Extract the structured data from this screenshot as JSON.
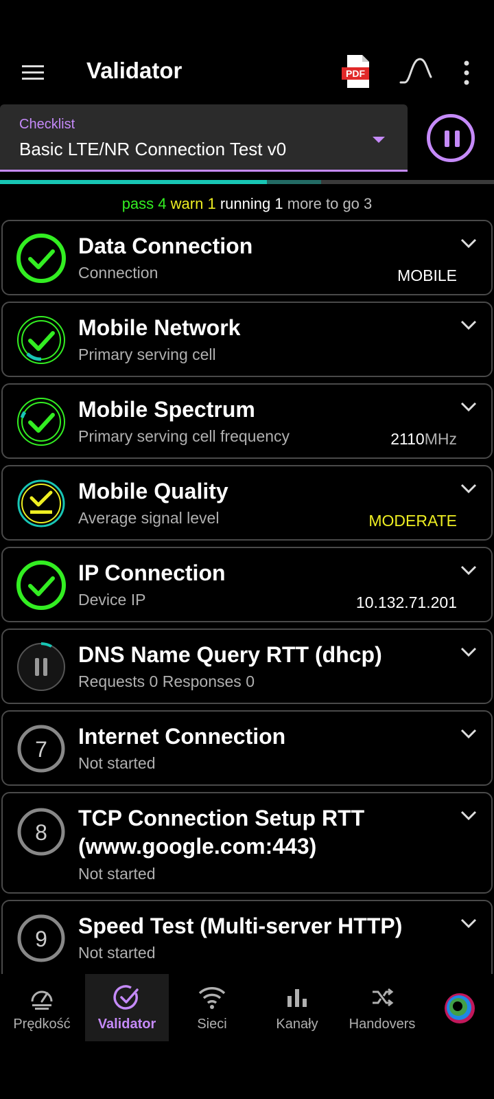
{
  "appbar": {
    "title": "Validator",
    "pdf_label": "PDF"
  },
  "checklist": {
    "label": "Checklist",
    "value": "Basic LTE/NR Connection Test v0"
  },
  "progress": {
    "pass_fraction": 0.54,
    "running_fraction": 0.11
  },
  "summary": {
    "pass_label": "pass",
    "pass_count": "4",
    "warn_label": "warn",
    "warn_count": "1",
    "running_label": "running",
    "running_count": "1",
    "more_label": "more to go",
    "more_count": "3"
  },
  "tests": [
    {
      "title": "Data Connection",
      "subtitle": "Connection",
      "value": "MOBILE",
      "value_unit": "",
      "status": "pass"
    },
    {
      "title": "Mobile Network",
      "subtitle": "Primary serving cell",
      "value": "",
      "value_unit": "",
      "status": "pass"
    },
    {
      "title": "Mobile Spectrum",
      "subtitle": "Primary serving cell frequency",
      "value": "2110",
      "value_unit": "MHz",
      "status": "pass"
    },
    {
      "title": "Mobile Quality",
      "subtitle": "Average signal level",
      "value": "MODERATE",
      "value_unit": "",
      "status": "warn"
    },
    {
      "title": "IP Connection",
      "subtitle": "Device IP",
      "value": "10.132.71.201",
      "value_unit": "",
      "status": "pass"
    },
    {
      "title": "DNS Name Query RTT (dhcp)",
      "subtitle": "Requests 0 Responses 0",
      "value": "",
      "value_unit": "",
      "status": "running"
    },
    {
      "title": "Internet Connection",
      "subtitle": "Not started",
      "value": "",
      "value_unit": "",
      "status": "pending",
      "number": "7"
    },
    {
      "title": "TCP Connection Setup RTT (www.google.com:443)",
      "subtitle": "Not started",
      "value": "",
      "value_unit": "",
      "status": "pending",
      "number": "8"
    },
    {
      "title": "Speed Test (Multi-server HTTP)",
      "subtitle": "Not started",
      "value": "",
      "value_unit": "",
      "status": "pending",
      "number": "9"
    }
  ],
  "nav": [
    {
      "label": "Prędkość",
      "icon": "speedometer-icon"
    },
    {
      "label": "Validator",
      "icon": "check-circle-icon",
      "active": true
    },
    {
      "label": "Sieci",
      "icon": "wifi-icon"
    },
    {
      "label": "Kanały",
      "icon": "bar-chart-icon"
    },
    {
      "label": "Handovers",
      "icon": "shuffle-icon"
    }
  ],
  "colors": {
    "accent": "#c58af9",
    "pass": "#33ee22",
    "warn": "#eeee22",
    "teal": "#18c6b5"
  }
}
